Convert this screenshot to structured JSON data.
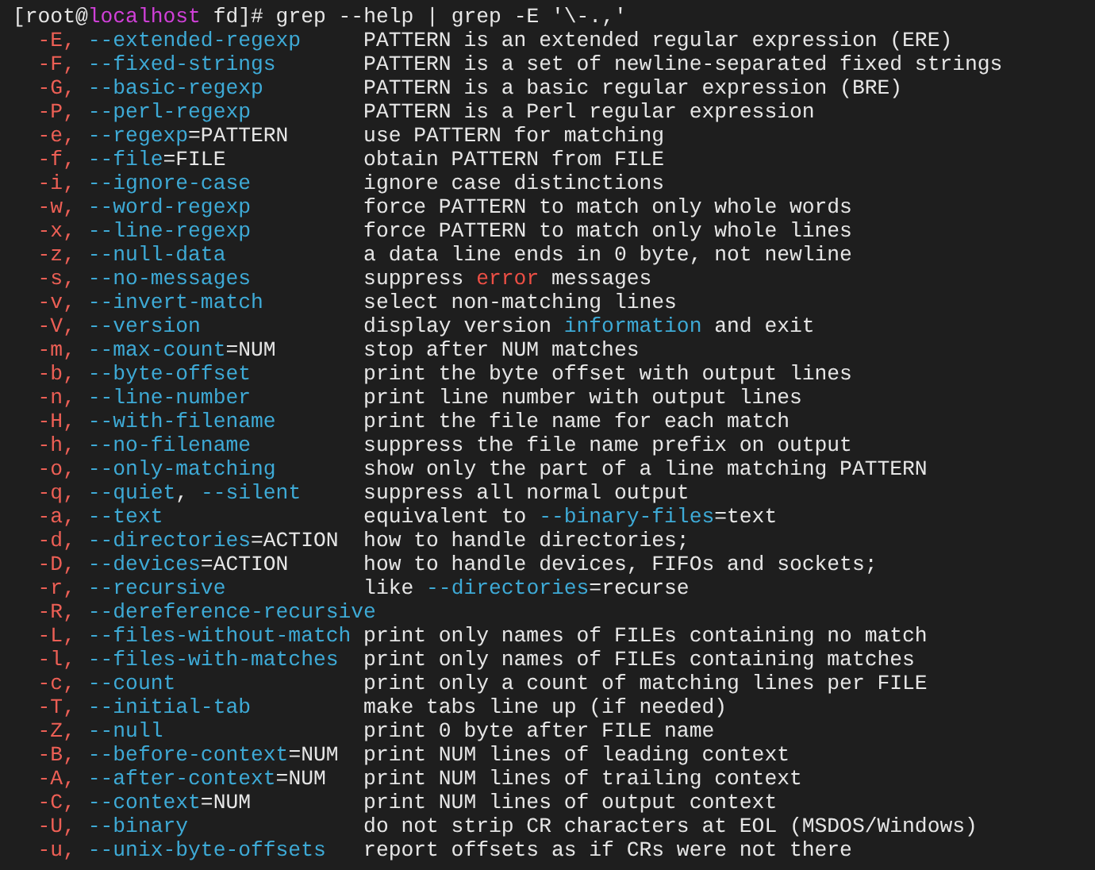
{
  "prompt": [
    {
      "text": "[root@",
      "kind": "plain"
    },
    {
      "text": "localhost",
      "kind": "host"
    },
    {
      "text": " fd]# grep --help | grep -E '\\-.,'",
      "kind": "plain"
    }
  ],
  "options": [
    {
      "option": [
        {
          "text": "-E,",
          "kind": "flag"
        },
        {
          "text": " --extended-regexp",
          "kind": "long"
        }
      ],
      "description": [
        {
          "text": "PATTERN is an extended regular expression (ERE)",
          "kind": "plain"
        }
      ]
    },
    {
      "option": [
        {
          "text": "-F,",
          "kind": "flag"
        },
        {
          "text": " --fixed-strings",
          "kind": "long"
        }
      ],
      "description": [
        {
          "text": "PATTERN is a set of newline-separated fixed strings",
          "kind": "plain"
        }
      ]
    },
    {
      "option": [
        {
          "text": "-G,",
          "kind": "flag"
        },
        {
          "text": " --basic-regexp",
          "kind": "long"
        }
      ],
      "description": [
        {
          "text": "PATTERN is a basic regular expression (BRE)",
          "kind": "plain"
        }
      ]
    },
    {
      "option": [
        {
          "text": "-P,",
          "kind": "flag"
        },
        {
          "text": " --perl-regexp",
          "kind": "long"
        }
      ],
      "description": [
        {
          "text": "PATTERN is a Perl regular expression",
          "kind": "plain"
        }
      ]
    },
    {
      "option": [
        {
          "text": "-e,",
          "kind": "flag"
        },
        {
          "text": " --regexp",
          "kind": "long"
        },
        {
          "text": "=PATTERN",
          "kind": "plain"
        }
      ],
      "description": [
        {
          "text": "use PATTERN for matching",
          "kind": "plain"
        }
      ]
    },
    {
      "option": [
        {
          "text": "-f,",
          "kind": "flag"
        },
        {
          "text": " --file",
          "kind": "long"
        },
        {
          "text": "=FILE",
          "kind": "plain"
        }
      ],
      "description": [
        {
          "text": "obtain PATTERN from FILE",
          "kind": "plain"
        }
      ]
    },
    {
      "option": [
        {
          "text": "-i,",
          "kind": "flag"
        },
        {
          "text": " --ignore-case",
          "kind": "long"
        }
      ],
      "description": [
        {
          "text": "ignore case distinctions",
          "kind": "plain"
        }
      ]
    },
    {
      "option": [
        {
          "text": "-w,",
          "kind": "flag"
        },
        {
          "text": " --word-regexp",
          "kind": "long"
        }
      ],
      "description": [
        {
          "text": "force PATTERN to match only whole words",
          "kind": "plain"
        }
      ]
    },
    {
      "option": [
        {
          "text": "-x,",
          "kind": "flag"
        },
        {
          "text": " --line-regexp",
          "kind": "long"
        }
      ],
      "description": [
        {
          "text": "force PATTERN to match only whole lines",
          "kind": "plain"
        }
      ]
    },
    {
      "option": [
        {
          "text": "-z,",
          "kind": "flag"
        },
        {
          "text": " --null-data",
          "kind": "long"
        }
      ],
      "description": [
        {
          "text": "a data line ends in 0 byte, not newline",
          "kind": "plain"
        }
      ]
    },
    {
      "option": [
        {
          "text": "-s,",
          "kind": "flag"
        },
        {
          "text": " --no-messages",
          "kind": "long"
        }
      ],
      "description": [
        {
          "text": "suppress ",
          "kind": "plain"
        },
        {
          "text": "error",
          "kind": "alert"
        },
        {
          "text": " messages",
          "kind": "plain"
        }
      ]
    },
    {
      "option": [
        {
          "text": "-v,",
          "kind": "flag"
        },
        {
          "text": " --invert-match",
          "kind": "long"
        }
      ],
      "description": [
        {
          "text": "select non-matching lines",
          "kind": "plain"
        }
      ]
    },
    {
      "option": [
        {
          "text": "-V,",
          "kind": "flag"
        },
        {
          "text": " --version",
          "kind": "long"
        }
      ],
      "description": [
        {
          "text": "display version ",
          "kind": "plain"
        },
        {
          "text": "information",
          "kind": "long"
        },
        {
          "text": " and exit",
          "kind": "plain"
        }
      ]
    },
    {
      "option": [
        {
          "text": "-m,",
          "kind": "flag"
        },
        {
          "text": " --max-count",
          "kind": "long"
        },
        {
          "text": "=NUM",
          "kind": "plain"
        }
      ],
      "description": [
        {
          "text": "stop after NUM matches",
          "kind": "plain"
        }
      ]
    },
    {
      "option": [
        {
          "text": "-b,",
          "kind": "flag"
        },
        {
          "text": " --byte-offset",
          "kind": "long"
        }
      ],
      "description": [
        {
          "text": "print the byte offset with output lines",
          "kind": "plain"
        }
      ]
    },
    {
      "option": [
        {
          "text": "-n,",
          "kind": "flag"
        },
        {
          "text": " --line-number",
          "kind": "long"
        }
      ],
      "description": [
        {
          "text": "print line number with output lines",
          "kind": "plain"
        }
      ]
    },
    {
      "option": [
        {
          "text": "-H,",
          "kind": "flag"
        },
        {
          "text": " --with-filename",
          "kind": "long"
        }
      ],
      "description": [
        {
          "text": "print the file name for each match",
          "kind": "plain"
        }
      ]
    },
    {
      "option": [
        {
          "text": "-h,",
          "kind": "flag"
        },
        {
          "text": " --no-filename",
          "kind": "long"
        }
      ],
      "description": [
        {
          "text": "suppress the file name prefix on output",
          "kind": "plain"
        }
      ]
    },
    {
      "option": [
        {
          "text": "-o,",
          "kind": "flag"
        },
        {
          "text": " --only-matching",
          "kind": "long"
        }
      ],
      "description": [
        {
          "text": "show only the part of a line matching PATTERN",
          "kind": "plain"
        }
      ]
    },
    {
      "option": [
        {
          "text": "-q,",
          "kind": "flag"
        },
        {
          "text": " --quiet",
          "kind": "long"
        },
        {
          "text": ", ",
          "kind": "plain"
        },
        {
          "text": "--silent",
          "kind": "long"
        }
      ],
      "description": [
        {
          "text": "suppress all normal output",
          "kind": "plain"
        }
      ]
    },
    {
      "option": [
        {
          "text": "-a,",
          "kind": "flag"
        },
        {
          "text": " --text",
          "kind": "long"
        }
      ],
      "description": [
        {
          "text": "equivalent to ",
          "kind": "plain"
        },
        {
          "text": "--binary-files",
          "kind": "long"
        },
        {
          "text": "=text",
          "kind": "plain"
        }
      ]
    },
    {
      "option": [
        {
          "text": "-d,",
          "kind": "flag"
        },
        {
          "text": " --directories",
          "kind": "long"
        },
        {
          "text": "=ACTION",
          "kind": "plain"
        }
      ],
      "description": [
        {
          "text": "how to handle directories;",
          "kind": "plain"
        }
      ]
    },
    {
      "option": [
        {
          "text": "-D,",
          "kind": "flag"
        },
        {
          "text": " --devices",
          "kind": "long"
        },
        {
          "text": "=ACTION",
          "kind": "plain"
        }
      ],
      "description": [
        {
          "text": "how to handle devices, FIFOs and sockets;",
          "kind": "plain"
        }
      ]
    },
    {
      "option": [
        {
          "text": "-r,",
          "kind": "flag"
        },
        {
          "text": " --recursive",
          "kind": "long"
        }
      ],
      "description": [
        {
          "text": "like ",
          "kind": "plain"
        },
        {
          "text": "--directories",
          "kind": "long"
        },
        {
          "text": "=recurse",
          "kind": "plain"
        }
      ]
    },
    {
      "option": [
        {
          "text": "-R,",
          "kind": "flag"
        },
        {
          "text": " --dereference-recursive",
          "kind": "long"
        }
      ]
    },
    {
      "option": [
        {
          "text": "-L,",
          "kind": "flag"
        },
        {
          "text": " --files-without-match",
          "kind": "long"
        }
      ],
      "description": [
        {
          "text": "print only names of FILEs containing no match",
          "kind": "plain"
        }
      ]
    },
    {
      "option": [
        {
          "text": "-l,",
          "kind": "flag"
        },
        {
          "text": " --files-with-matches",
          "kind": "long"
        }
      ],
      "description": [
        {
          "text": "print only names of FILEs containing matches",
          "kind": "plain"
        }
      ]
    },
    {
      "option": [
        {
          "text": "-c,",
          "kind": "flag"
        },
        {
          "text": " --count",
          "kind": "long"
        }
      ],
      "description": [
        {
          "text": "print only a count of matching lines per FILE",
          "kind": "plain"
        }
      ]
    },
    {
      "option": [
        {
          "text": "-T,",
          "kind": "flag"
        },
        {
          "text": " --initial-tab",
          "kind": "long"
        }
      ],
      "description": [
        {
          "text": "make tabs line up (if needed)",
          "kind": "plain"
        }
      ]
    },
    {
      "option": [
        {
          "text": "-Z,",
          "kind": "flag"
        },
        {
          "text": " --null",
          "kind": "long"
        }
      ],
      "description": [
        {
          "text": "print 0 byte after FILE name",
          "kind": "plain"
        }
      ]
    },
    {
      "option": [
        {
          "text": "-B,",
          "kind": "flag"
        },
        {
          "text": " --before-context",
          "kind": "long"
        },
        {
          "text": "=NUM",
          "kind": "plain"
        }
      ],
      "description": [
        {
          "text": "print NUM lines of leading context",
          "kind": "plain"
        }
      ]
    },
    {
      "option": [
        {
          "text": "-A,",
          "kind": "flag"
        },
        {
          "text": " --after-context",
          "kind": "long"
        },
        {
          "text": "=NUM",
          "kind": "plain"
        }
      ],
      "description": [
        {
          "text": "print NUM lines of trailing context",
          "kind": "plain"
        }
      ]
    },
    {
      "option": [
        {
          "text": "-C,",
          "kind": "flag"
        },
        {
          "text": " --context",
          "kind": "long"
        },
        {
          "text": "=NUM",
          "kind": "plain"
        }
      ],
      "description": [
        {
          "text": "print NUM lines of output context",
          "kind": "plain"
        }
      ]
    },
    {
      "option": [
        {
          "text": "-U,",
          "kind": "flag"
        },
        {
          "text": " --binary",
          "kind": "long"
        }
      ],
      "description": [
        {
          "text": "do not strip CR characters at EOL (MSDOS/Windows)",
          "kind": "plain"
        }
      ]
    },
    {
      "option": [
        {
          "text": "-u,",
          "kind": "flag"
        },
        {
          "text": " --unix-byte-offsets",
          "kind": "long"
        }
      ],
      "description": [
        {
          "text": "report offsets as if CRs were not there",
          "kind": "plain"
        }
      ]
    }
  ]
}
